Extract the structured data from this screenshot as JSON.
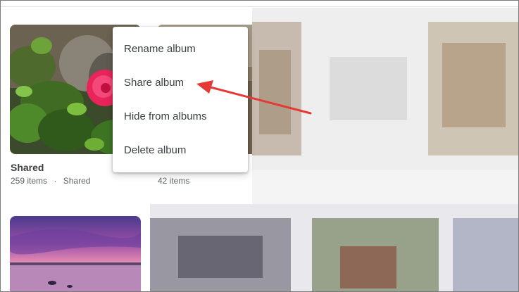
{
  "albums": [
    {
      "title": "Shared",
      "count": "259 items",
      "separator": "·",
      "shared_label": "Shared"
    },
    {
      "title": "",
      "count": "42 items"
    }
  ],
  "menu": {
    "items": [
      {
        "label": "Rename album"
      },
      {
        "label": "Share album"
      },
      {
        "label": "Hide from albums"
      },
      {
        "label": "Delete album"
      }
    ]
  },
  "annotation": {
    "arrow_color": "#e53935",
    "points_to": "Share album"
  }
}
